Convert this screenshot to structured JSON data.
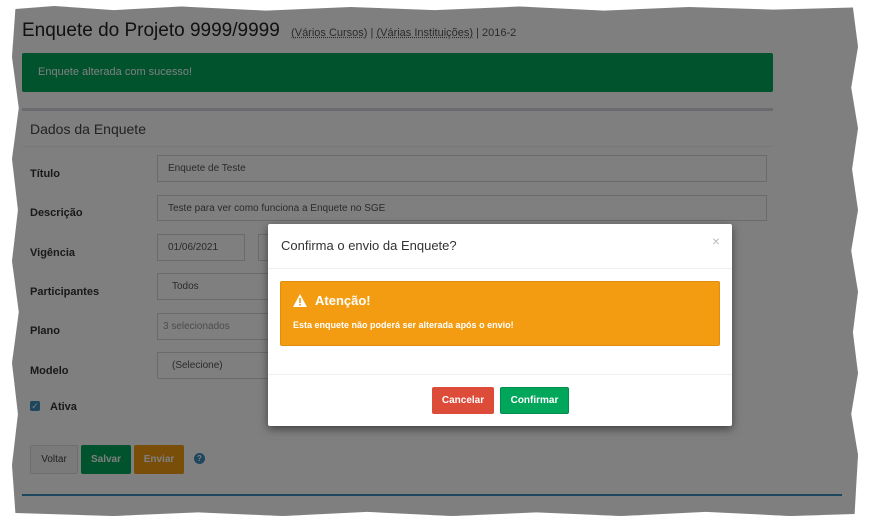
{
  "header": {
    "title": "Enquete do Projeto 9999/9999",
    "courses": "(Vários Cursos)",
    "institutions": "(Várias Instituições)",
    "separator": "|",
    "period": "2016-2"
  },
  "alert": {
    "message": "Enquete alterada com sucesso!"
  },
  "form": {
    "box_title": "Dados da Enquete",
    "fields": {
      "titulo": {
        "label": "Título",
        "value": "Enquete de Teste"
      },
      "descricao": {
        "label": "Descrição",
        "value": "Teste para ver como funciona a Enquete no SGE"
      },
      "vigencia": {
        "label": "Vigência",
        "start": "01/06/2021",
        "end": ""
      },
      "participantes": {
        "label": "Participantes",
        "value": "Todos"
      },
      "plano": {
        "label": "Plano",
        "value": "3 selecionados"
      },
      "modelo": {
        "label": "Modelo",
        "value": "(Selecione)"
      },
      "ativa": {
        "label": "Ativa",
        "checked": true
      }
    },
    "buttons": {
      "back": "Voltar",
      "save": "Salvar",
      "send": "Enviar"
    },
    "help_icon": "question-circle-icon"
  },
  "modal": {
    "title": "Confirma o envio da Enquete?",
    "close": "×",
    "warning_title": "Atenção!",
    "warning_text": "Esta enquete não poderá ser alterada após o envio!",
    "cancel_label": "Cancelar",
    "confirm_label": "Confirmar"
  },
  "colors": {
    "success": "#00a65a",
    "warning": "#f39c12",
    "danger": "#dd4b39",
    "primary": "#3c8dbc"
  }
}
